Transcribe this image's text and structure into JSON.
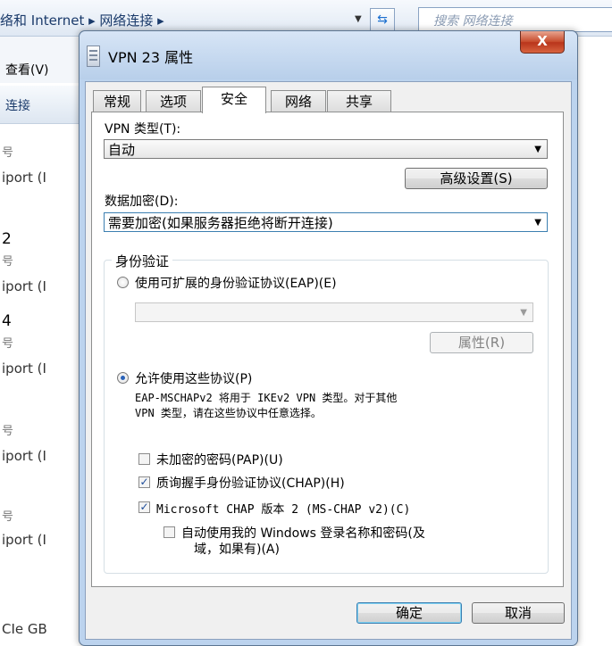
{
  "background": {
    "breadcrumb": "络和 Internet ▸ 网络连接 ▸",
    "search_placeholder": "搜索 网络连接",
    "menu_view": "查看(V)",
    "toolbar_connect": "连接",
    "items": [
      "号",
      "iport (I",
      "2",
      "号",
      "iport (I",
      "4",
      "号",
      "iport (I",
      "号",
      "iport (I",
      "号",
      "iport (I",
      "CIe GB"
    ]
  },
  "dialog": {
    "title": "VPN 23 属性",
    "close_label": "X",
    "tabs": [
      "常规",
      "选项",
      "安全",
      "网络",
      "共享"
    ],
    "active_tab": "安全",
    "vpn_type_label": "VPN 类型(T):",
    "vpn_type_value": "自动",
    "advanced_button": "高级设置(S)",
    "encryption_label": "数据加密(D):",
    "encryption_value": "需要加密(如果服务器拒绝将断开连接)",
    "auth_group_title": "身份验证",
    "eap_radio_label": "使用可扩展的身份验证协议(EAP)(E)",
    "eap_selected": false,
    "eap_combo_value": "",
    "properties_button": "属性(R)",
    "allow_radio_label": "允许使用这些协议(P)",
    "allow_selected": true,
    "allow_note_line1": "EAP-MSCHAPv2 将用于 IKEv2 VPN 类型。对于其他",
    "allow_note_line2": "VPN 类型，请在这些协议中任意选择。",
    "protocols": [
      {
        "label": "未加密的密码(PAP)(U)",
        "checked": false
      },
      {
        "label": "质询握手身份验证协议(CHAP)(H)",
        "checked": true
      },
      {
        "label": "Microsoft CHAP 版本 2 (MS-CHAP v2)(C)",
        "checked": true
      }
    ],
    "auto_windows_line1": "自动使用我的 Windows 登录名称和密码(及",
    "auto_windows_line2": "域，如果有)(A)",
    "auto_windows_checked": false,
    "ok_button": "确定",
    "cancel_button": "取消"
  }
}
